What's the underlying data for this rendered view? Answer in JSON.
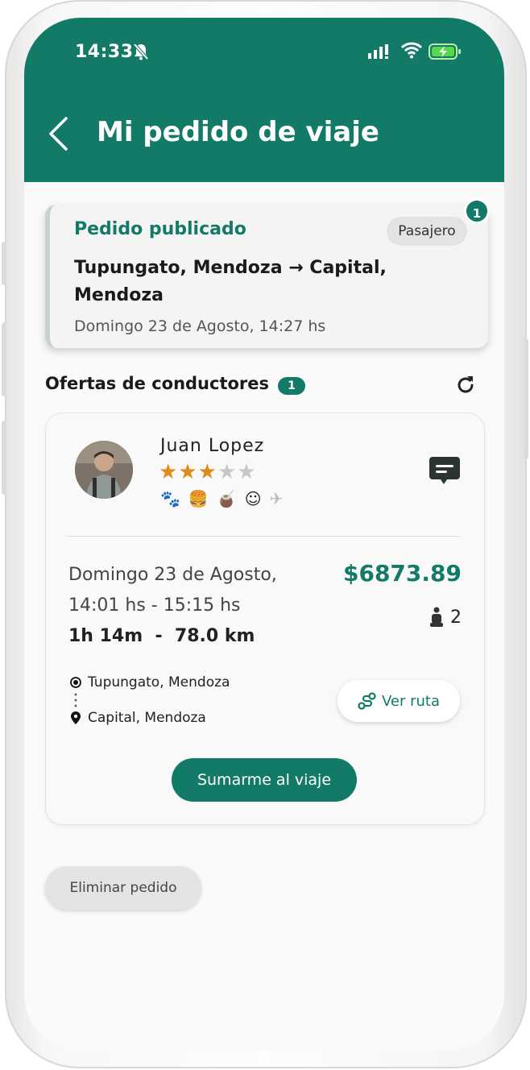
{
  "status_bar": {
    "time": "14:33"
  },
  "header": {
    "title": "Mi pedido de viaje"
  },
  "request": {
    "status": "Pedido publicado",
    "role_badge": "Pasajero",
    "notification_count": "1",
    "route": "Tupungato, Mendoza → Capital, Mendoza",
    "date": "Domingo 23 de Agosto, 14:27 hs"
  },
  "offers": {
    "title": "Ofertas de conductores",
    "count": "1",
    "items": [
      {
        "driver_name": "Juan Lopez",
        "rating": 3,
        "rating_max": 5,
        "date_line1": "Domingo 23 de Agosto,",
        "date_line2": "14:01 hs - 15:15 hs",
        "duration_distance": "1h 14m  -  78.0 km",
        "price": "$6873.89",
        "seats": "2",
        "origin": "Tupungato, Mendoza",
        "destination": "Capital, Mendoza",
        "route_button": "Ver ruta",
        "join_button": "Sumarme al viaje"
      }
    ]
  },
  "delete_button": "Eliminar pedido",
  "colors": {
    "primary": "#137a68",
    "star_filled": "#e08a1e",
    "star_empty": "#c7c7c7"
  }
}
